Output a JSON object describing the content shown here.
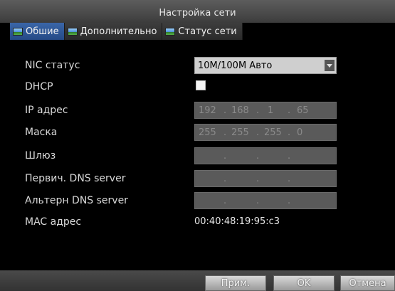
{
  "window": {
    "title": "Настройка сети"
  },
  "tabs": [
    {
      "label": "Обшие",
      "active": true
    },
    {
      "label": "Дополнительно",
      "active": false
    },
    {
      "label": "Статус сети",
      "active": false
    }
  ],
  "form": {
    "nic": {
      "label": "NIC статус",
      "value": "10M/100M Авто"
    },
    "dhcp": {
      "label": "DHCP",
      "checked": false
    },
    "ip": {
      "label": "IP адрес",
      "parts": [
        "192",
        "168",
        "1",
        "65"
      ]
    },
    "mask": {
      "label": "Маска",
      "parts": [
        "255",
        "255",
        "255",
        "0"
      ]
    },
    "gateway": {
      "label": "Шлюз",
      "parts": [
        "",
        "",
        "",
        ""
      ]
    },
    "dns1": {
      "label": "Первич. DNS server",
      "parts": [
        "",
        "",
        "",
        ""
      ]
    },
    "dns2": {
      "label": "Альтерн DNS server",
      "parts": [
        "",
        "",
        "",
        ""
      ]
    },
    "mac": {
      "label": "MAC адрес",
      "value": "00:40:48:19:95:c3"
    }
  },
  "footer": {
    "apply_label": "Прим.",
    "ok_label": "OK",
    "cancel_label": "Отмена"
  }
}
